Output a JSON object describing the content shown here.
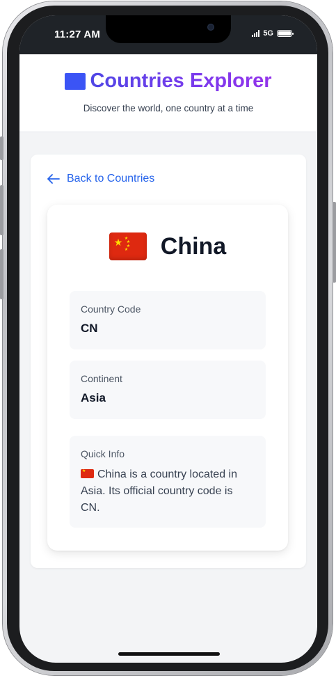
{
  "status_bar": {
    "time": "11:27 AM",
    "network": "5G"
  },
  "header": {
    "title": "Countries Explorer",
    "subtitle": "Discover the world, one country at a time",
    "title_gradient": [
      "#4f46e5",
      "#9333ea"
    ]
  },
  "nav": {
    "back_label": "Back to Countries",
    "back_icon": "arrow-left-icon",
    "link_color": "#2563eb"
  },
  "country": {
    "flag_icon": "china-flag-icon",
    "name": "China",
    "fields": [
      {
        "label": "Country Code",
        "value": "CN"
      },
      {
        "label": "Continent",
        "value": "Asia"
      }
    ],
    "quick_info": {
      "label": "Quick Info",
      "text": "China is a country located in Asia. Its official country code is CN."
    }
  }
}
